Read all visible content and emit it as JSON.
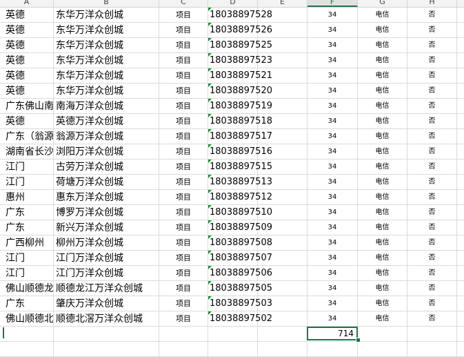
{
  "columns": [
    "A",
    "B",
    "C",
    "D",
    "E",
    "F",
    "G",
    "H"
  ],
  "selected_column": "F",
  "rows": [
    {
      "a": "英德",
      "b": "东华万洋众创城",
      "c": "项目",
      "d": "18038897528",
      "f": "34",
      "g": "电信",
      "h": "否"
    },
    {
      "a": "英德",
      "b": "东华万洋众创城",
      "c": "项目",
      "d": "18038897526",
      "f": "34",
      "g": "电信",
      "h": "否"
    },
    {
      "a": "英德",
      "b": "东华万洋众创城",
      "c": "项目",
      "d": "18038897525",
      "f": "34",
      "g": "电信",
      "h": "否"
    },
    {
      "a": "英德",
      "b": "东华万洋众创城",
      "c": "项目",
      "d": "18038897523",
      "f": "34",
      "g": "电信",
      "h": "否"
    },
    {
      "a": "英德",
      "b": "东华万洋众创城",
      "c": "项目",
      "d": "18038897521",
      "f": "34",
      "g": "电信",
      "h": "否"
    },
    {
      "a": "英德",
      "b": "东华万洋众创城",
      "c": "项目",
      "d": "18038897520",
      "f": "34",
      "g": "电信",
      "h": "否"
    },
    {
      "a": "广东佛山南",
      "b": "南海万洋众创城",
      "c": "项目",
      "d": "18038897519",
      "f": "34",
      "g": "电信",
      "h": "否"
    },
    {
      "a": "英德",
      "b": "英德万洋众创城",
      "c": "项目",
      "d": "18038897518",
      "f": "34",
      "g": "电信",
      "h": "否"
    },
    {
      "a": "广东（翁源",
      "b": "翁源万洋众创城",
      "c": "项目",
      "d": "18038897517",
      "f": "34",
      "g": "电信",
      "h": "否"
    },
    {
      "a": "湖南省长沙",
      "b": "浏阳万洋众创城",
      "c": "项目",
      "d": "18038897516",
      "f": "34",
      "g": "电信",
      "h": "否"
    },
    {
      "a": "江门",
      "b": "古劳万洋众创城",
      "c": "项目",
      "d": "18038897515",
      "f": "34",
      "g": "电信",
      "h": "否"
    },
    {
      "a": "江门",
      "b": "荷塘万洋众创城",
      "c": "项目",
      "d": "18038897513",
      "f": "34",
      "g": "电信",
      "h": "否"
    },
    {
      "a": "惠州",
      "b": "惠东万洋众创城",
      "c": "项目",
      "d": "18038897512",
      "f": "34",
      "g": "电信",
      "h": "否"
    },
    {
      "a": "广东",
      "b": "博罗万洋众创城",
      "c": "项目",
      "d": "18038897510",
      "f": "34",
      "g": "电信",
      "h": "否"
    },
    {
      "a": "广东",
      "b": "新兴万洋众创城",
      "c": "项目",
      "d": "18038897509",
      "f": "34",
      "g": "电信",
      "h": "否"
    },
    {
      "a": "广西柳州",
      "b": "柳州万洋众创城",
      "c": "项目",
      "d": "18038897508",
      "f": "34",
      "g": "电信",
      "h": "否"
    },
    {
      "a": "江门",
      "b": "江门万洋众创城",
      "c": "项目",
      "d": "18038897507",
      "f": "34",
      "g": "电信",
      "h": "否"
    },
    {
      "a": "江门",
      "b": "江门万洋众创城",
      "c": "项目",
      "d": "18038897506",
      "f": "34",
      "g": "电信",
      "h": "否"
    },
    {
      "a": "佛山顺德龙",
      "b": "顺德龙江万洋众创城",
      "c": "项目",
      "d": "18038897505",
      "f": "34",
      "g": "电信",
      "h": "否"
    },
    {
      "a": "广东",
      "b": "肇庆万洋众创城",
      "c": "项目",
      "d": "18038897503",
      "f": "34",
      "g": "电信",
      "h": "否"
    },
    {
      "a": "佛山顺德北",
      "b": "顺德北滘万洋众创城",
      "c": "项目",
      "d": "18038897502",
      "f": "34",
      "g": "电信",
      "h": "否"
    }
  ],
  "active_cell": {
    "value": "714"
  },
  "colors": {
    "accent": "#217346",
    "marker": "#1f8f3c"
  }
}
